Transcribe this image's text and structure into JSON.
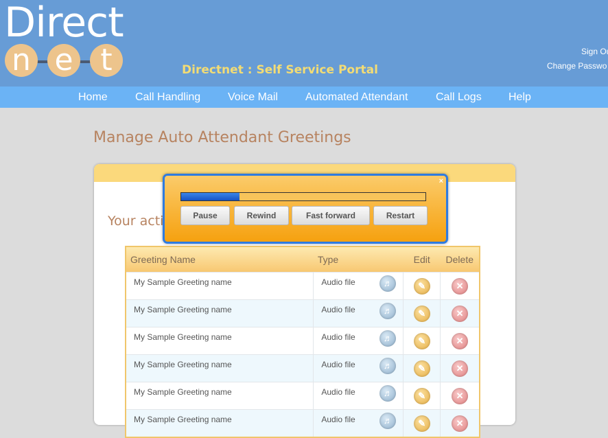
{
  "brand": {
    "logo_top": "Direct",
    "logo_letters": [
      "n",
      "e",
      "t"
    ],
    "portal_title": "Directnet : Self Service Portal",
    "colors": {
      "header": "#679cd6",
      "nav": "#6bb3f5",
      "accent": "#f3dc74"
    }
  },
  "top_links": {
    "sign_out": "Sign Ou",
    "change_password": "Change Passwo"
  },
  "nav": {
    "items": [
      "Home",
      "Call Handling",
      "Voice Mail",
      "Automated Attendant",
      "Call Logs",
      "Help"
    ]
  },
  "page": {
    "title": "Manage Auto Attendant Greetings",
    "subtitle_visible": "Your activ"
  },
  "table": {
    "headers": {
      "name": "Greeting Name",
      "type": "Type",
      "edit": "Edit",
      "delete": "Delete"
    },
    "rows": [
      {
        "name": "My Sample Greeting name",
        "type": "Audio file"
      },
      {
        "name": "My Sample Greeting name",
        "type": "Audio file"
      },
      {
        "name": "My Sample Greeting name",
        "type": "Audio file"
      },
      {
        "name": "My Sample Greeting name",
        "type": "Audio file"
      },
      {
        "name": "My Sample Greeting name",
        "type": "Audio file"
      },
      {
        "name": "My Sample Greeting name",
        "type": "Audio file"
      }
    ],
    "icons": {
      "play": "speaker-icon",
      "edit": "pencil-icon",
      "delete": "x-icon"
    }
  },
  "player": {
    "progress_fraction": 0.24,
    "buttons": {
      "pause": "Pause",
      "rewind": "Rewind",
      "fast_forward": "Fast forward",
      "restart": "Restart"
    },
    "close_glyph": "×"
  }
}
